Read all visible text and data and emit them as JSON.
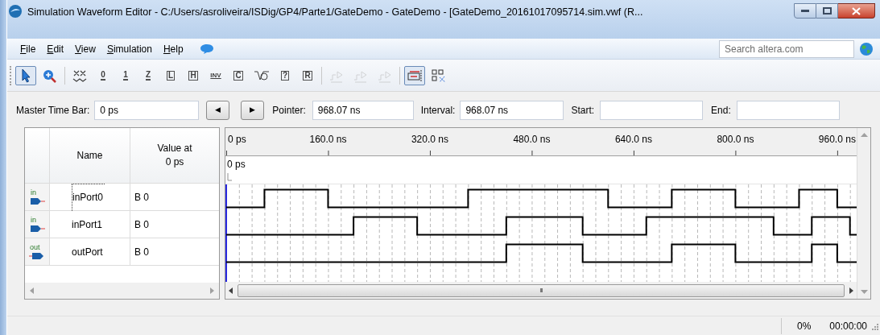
{
  "window": {
    "title": "Simulation Waveform Editor - C:/Users/asroliveira/ISDig/GP4/Parte1/GateDemo - GateDemo - [GateDemo_20161017095714.sim.vwf (R..."
  },
  "menu": [
    "File",
    "Edit",
    "View",
    "Simulation",
    "Help"
  ],
  "search": {
    "placeholder": "Search altera.com"
  },
  "toolbar": [
    {
      "kind": "pointer",
      "selected": true,
      "disabled": false
    },
    {
      "kind": "zoom",
      "selected": false,
      "disabled": false
    },
    {
      "kind": "unknown",
      "selected": false,
      "disabled": false
    },
    {
      "kind": "low",
      "glyph": "0",
      "selected": false,
      "disabled": false
    },
    {
      "kind": "high",
      "glyph": "1",
      "selected": false,
      "disabled": false
    },
    {
      "kind": "hiz",
      "glyph": "Z",
      "selected": false,
      "disabled": false
    },
    {
      "kind": "bus",
      "glyph": "L",
      "selected": false,
      "disabled": false
    },
    {
      "kind": "bus",
      "glyph": "H",
      "selected": false,
      "disabled": false
    },
    {
      "kind": "invert",
      "glyph": "INV",
      "selected": false,
      "disabled": false
    },
    {
      "kind": "bus",
      "glyph": "C",
      "selected": false,
      "disabled": false
    },
    {
      "kind": "clock",
      "selected": false,
      "disabled": false
    },
    {
      "kind": "bus",
      "glyph": "?",
      "selected": false,
      "disabled": false
    },
    {
      "kind": "bus",
      "glyph": "R",
      "selected": false,
      "disabled": false
    },
    {
      "kind": "run",
      "selected": false,
      "disabled": true
    },
    {
      "kind": "run",
      "selected": false,
      "disabled": true
    },
    {
      "kind": "run",
      "selected": false,
      "disabled": true
    },
    {
      "kind": "snap",
      "selected": true,
      "disabled": false
    },
    {
      "kind": "grid",
      "selected": false,
      "disabled": false
    }
  ],
  "time_controls": {
    "master_time_bar_label": "Master Time Bar:",
    "master_time_bar": "0 ps",
    "prev": "◀",
    "next": "▶",
    "pointer_label": "Pointer:",
    "pointer": "968.07 ns",
    "interval_label": "Interval:",
    "interval": "968.07 ns",
    "start_label": "Start:",
    "end_label": "End:"
  },
  "signals": {
    "columns": [
      "Name",
      "Value at\n0 ps"
    ],
    "rows": [
      {
        "kind": "input",
        "port_label": "in",
        "name": "inPort0",
        "value": "B 0",
        "selected": true
      },
      {
        "kind": "input",
        "port_label": "in",
        "name": "inPort1",
        "value": "B 0",
        "selected": false
      },
      {
        "kind": "output",
        "port_label": "out",
        "name": "outPort",
        "value": "B 0",
        "selected": false
      }
    ]
  },
  "waveform": {
    "time_bar_label": "0 ps",
    "scroll_grip": "III",
    "time_labels": [
      "0 ps",
      "160.0 ns",
      "320.0 ns",
      "480.0 ns",
      "640.0 ns",
      "800.0 ns",
      "960.0 ns"
    ]
  },
  "status_bar": {
    "progress": "0%",
    "elapsed": "00:00:00"
  }
}
